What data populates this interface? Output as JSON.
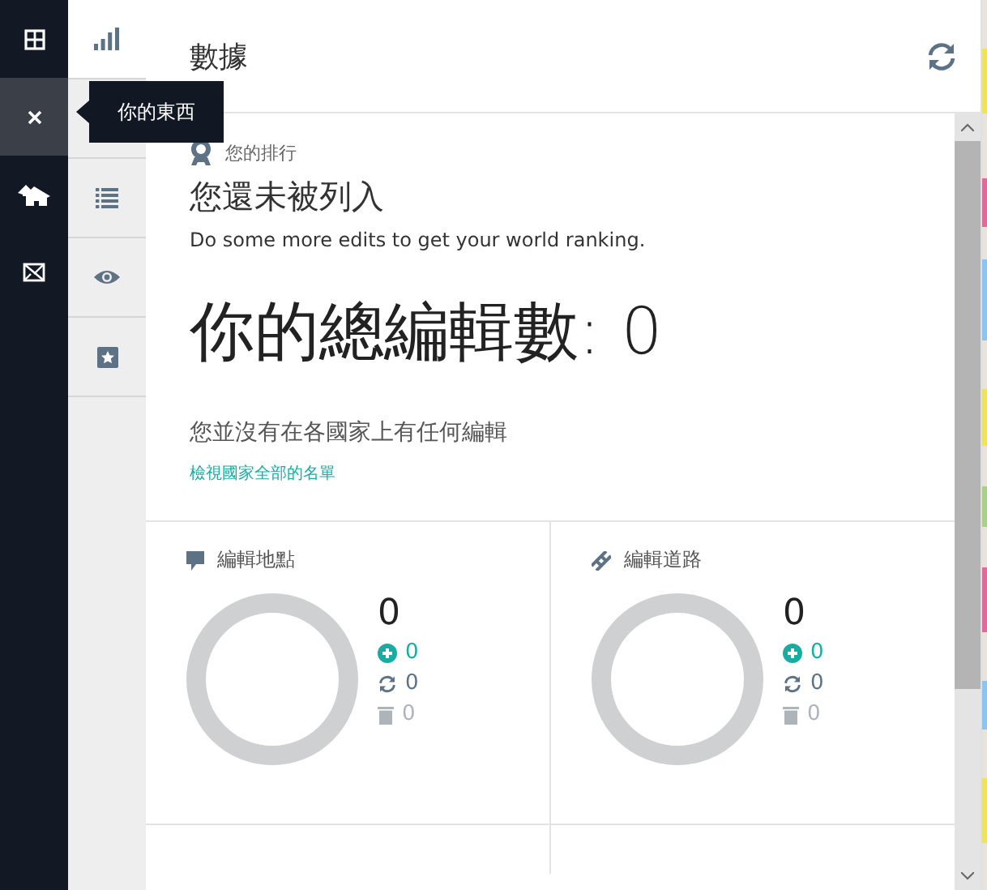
{
  "rail": [
    {
      "kind": "grid",
      "selected": false
    },
    {
      "kind": "close",
      "selected": true
    },
    {
      "kind": "home",
      "selected": false
    },
    {
      "kind": "map",
      "selected": false
    }
  ],
  "tooltip": "你的東西",
  "tabs": [
    {
      "kind": "chart",
      "selected": true
    },
    {
      "kind": "list",
      "selected": false
    },
    {
      "kind": "eye",
      "selected": false
    },
    {
      "kind": "star",
      "selected": false
    }
  ],
  "title": "數據",
  "ranking": {
    "label": "您的排行",
    "heading": "您還未被列入",
    "text": "Do some more edits to get your world ranking."
  },
  "total": "你的總編輯數: 0",
  "countries": {
    "text": "您並沒有在各國家上有任何編輯",
    "link": "檢視國家全部的名單"
  },
  "cards": [
    {
      "kind": "place",
      "title": "編輯地點",
      "total": "0",
      "added": "0",
      "modified": "0",
      "deleted": "0"
    },
    {
      "kind": "road",
      "title": "編輯道路",
      "total": "0",
      "added": "0",
      "modified": "0",
      "deleted": "0"
    }
  ]
}
